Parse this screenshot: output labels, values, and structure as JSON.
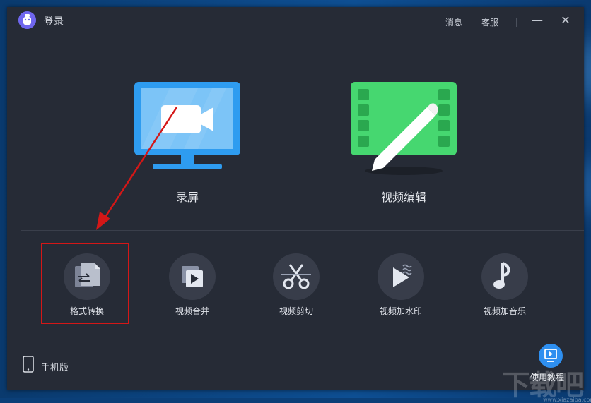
{
  "window": {
    "title": "登录"
  },
  "titlebar": {
    "messages_label": "消息",
    "service_label": "客服",
    "minimize_glyph": "—",
    "close_glyph": "✕"
  },
  "main_actions": [
    {
      "label": "录屏",
      "icon": "screen-record-icon",
      "color": "#2e9cf0"
    },
    {
      "label": "视频编辑",
      "icon": "video-edit-icon",
      "color": "#3ccf66"
    }
  ],
  "tools": [
    {
      "label": "格式转换",
      "icon": "format-convert-icon"
    },
    {
      "label": "视频合并",
      "icon": "video-merge-icon"
    },
    {
      "label": "视频剪切",
      "icon": "video-cut-icon"
    },
    {
      "label": "视频加水印",
      "icon": "video-watermark-icon"
    },
    {
      "label": "视频加音乐",
      "icon": "video-music-icon"
    }
  ],
  "footer": {
    "mobile_label": "手机版",
    "tutorial_label": "使用教程"
  },
  "watermark": {
    "text": "下载吧",
    "url_text": "www.xiazaiba.com"
  },
  "annotation": {
    "highlight_color": "#d41717"
  }
}
